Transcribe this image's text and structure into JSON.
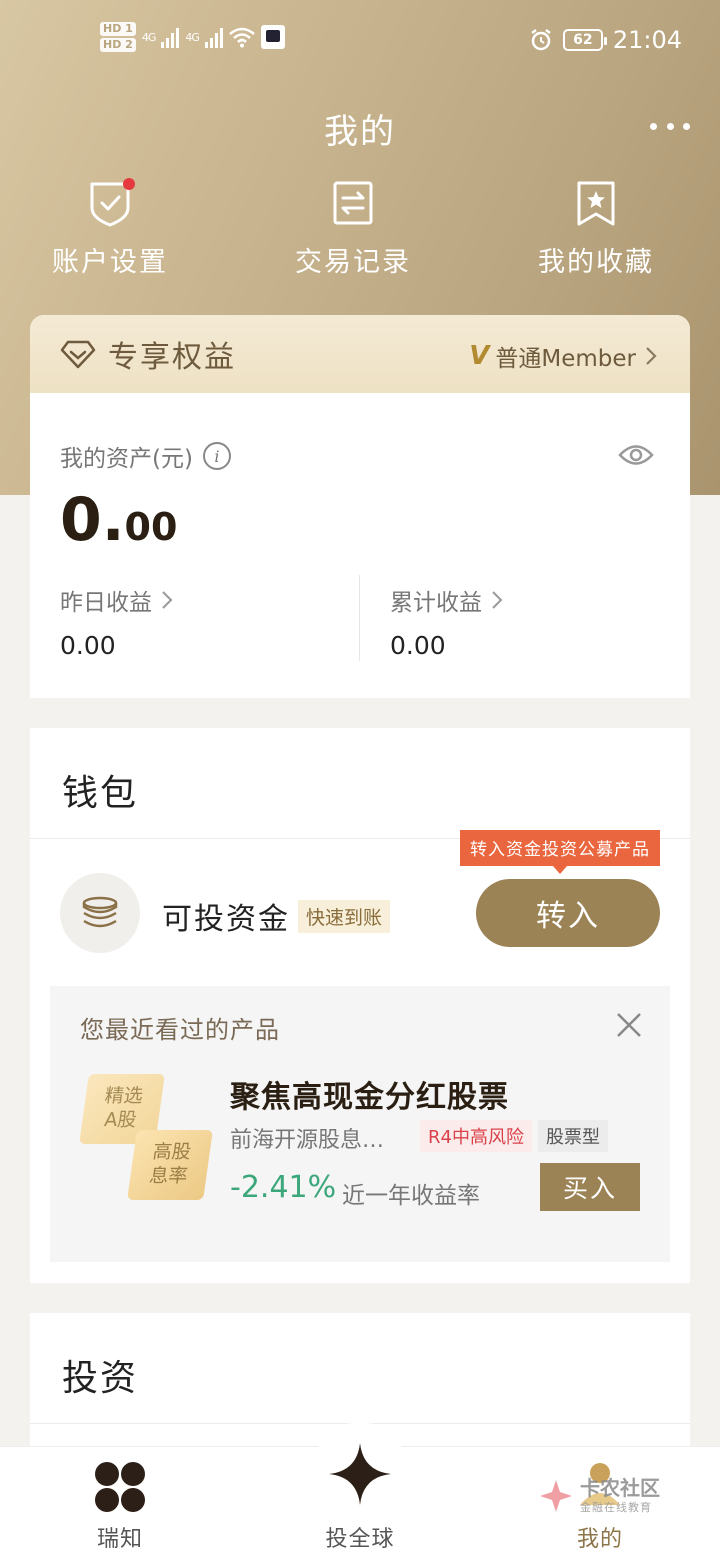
{
  "status_bar": {
    "hd1": "HD 1",
    "hd2": "HD 2",
    "net1": "4G",
    "net2": "4G",
    "battery": "62",
    "time": "21:04"
  },
  "header": {
    "title": "我的"
  },
  "quick_nav": [
    {
      "label": "账户设置",
      "icon": "shield-check-icon"
    },
    {
      "label": "交易记录",
      "icon": "exchange-record-icon"
    },
    {
      "label": "我的收藏",
      "icon": "bookmark-star-icon"
    }
  ],
  "benefits": {
    "title": "专享权益",
    "member_level": "普通Member"
  },
  "assets": {
    "label": "我的资产(元)",
    "value_int": "0.",
    "value_dec": "00",
    "yesterday_label": "昨日收益",
    "yesterday_value": "0.00",
    "total_label": "累计收益",
    "total_value": "0.00"
  },
  "wallet": {
    "title": "钱包",
    "promo_tag": "转入资金投资公募产品",
    "item_name": "可投资金",
    "item_badge": "快速到账",
    "transfer_label": "转入"
  },
  "recent": {
    "title": "您最近看过的产品",
    "badge_top_line1": "精选",
    "badge_top_line2": "A股",
    "badge_bottom_line1": "高股",
    "badge_bottom_line2": "息率",
    "product_name": "聚焦高现金分红股票",
    "product_fund": "前海开源股息…",
    "risk_tag": "R4中高风险",
    "type_tag": "股票型",
    "rate": "-2.41%",
    "rate_label": "近一年收益率",
    "buy_label": "买入",
    "colors": {
      "rate": "#3ba77a",
      "risk": "#d9424a"
    }
  },
  "invest": {
    "title": "投资"
  },
  "bottom_nav": [
    {
      "label": "瑞知",
      "icon": "four-dots-icon",
      "active": false
    },
    {
      "label": "投全球",
      "icon": "star-sparkle-icon",
      "active": false
    },
    {
      "label": "我的",
      "icon": "profile-icon",
      "active": true
    }
  ],
  "watermark": {
    "line1": "卡农社区",
    "line2": "金融在线教育"
  },
  "theme": {
    "accent": "#9c8356",
    "hero_gradient_start": "#d8c7a3",
    "hero_gradient_end": "#a9946e"
  }
}
